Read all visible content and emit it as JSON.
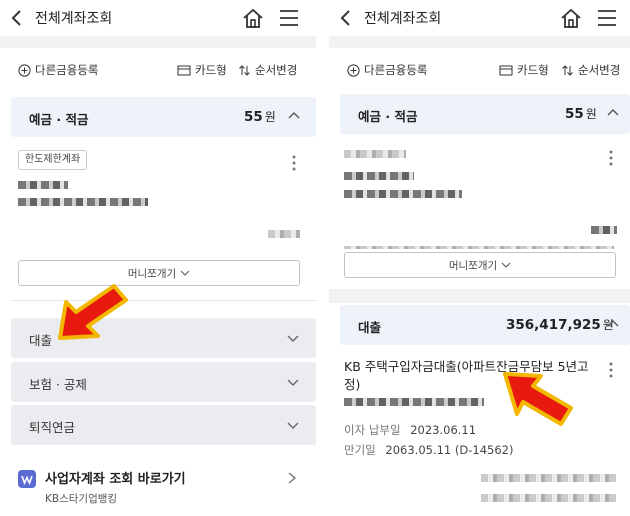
{
  "left": {
    "topbar": {
      "title": "전체계좌조회"
    },
    "actions": {
      "add_label": "다른금융등록",
      "card_label": "카드형",
      "order_label": "순서변경"
    },
    "deposit": {
      "name": "예금 · 적금",
      "amount": "55",
      "unit": "원",
      "tag": "한도제한계좌",
      "money_button": "머니쪼개기"
    },
    "sections": [
      {
        "name": "대출"
      },
      {
        "name": "보험 · 공제"
      },
      {
        "name": "퇴직연금"
      }
    ],
    "biz": {
      "title": "사업자계좌 조회 바로가기",
      "subtitle": "KB스타기업뱅킹"
    }
  },
  "right": {
    "topbar": {
      "title": "전체계좌조회"
    },
    "actions": {
      "add_label": "다른금융등록",
      "card_label": "카드형",
      "order_label": "순서변경"
    },
    "deposit": {
      "name": "예금 · 적금",
      "amount": "55",
      "unit": "원",
      "money_button": "머니쪼개기"
    },
    "loan": {
      "name": "대출",
      "amount": "356,417,925",
      "unit": "원",
      "product": "KB 주택구입자금대출(아파트잔금무담보 5년고정)",
      "interest_label": "이자 납부일",
      "interest_date": "2023.06.11",
      "maturity_label": "만기일",
      "maturity_date": "2063.05.11 (D-14562)"
    }
  },
  "colors": {
    "accent_red": "#e8190f",
    "arrow_yellow": "#f2b800",
    "section_bg": "#eef3fa",
    "gray_section_bg": "#ebecef"
  },
  "icons": [
    "back-arrow-icon",
    "home-icon",
    "hamburger-menu-icon",
    "plus-circle-icon",
    "card-icon",
    "sort-icon",
    "chevron-up-icon",
    "chevron-down-icon",
    "kebab-menu-icon",
    "chevron-right-icon",
    "red-arrow-icon"
  ]
}
